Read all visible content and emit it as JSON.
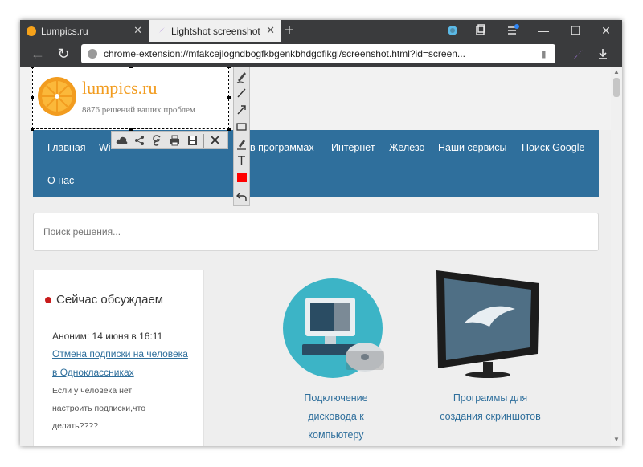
{
  "browser": {
    "tabs": [
      {
        "title": "Lumpics.ru",
        "active": false
      },
      {
        "title": "Lightshot screenshot",
        "active": true
      }
    ],
    "new_tab_icon": "plus-icon",
    "address": "chrome-extension://mfakcejlogndbogfkbgenkbhdgofikgl/screenshot.html?id=screen...",
    "colors": {
      "frame": "#3a3b3d",
      "active_tab": "#f0f0f0"
    }
  },
  "site": {
    "logo_name": "lumpics.ru",
    "logo_tagline": "8876 решений ваших проблем",
    "nav": [
      "Главная",
      "Wi",
      "в программах",
      "Интернет",
      "Железо",
      "Наши сервисы",
      "Поиск Google",
      "О нас"
    ],
    "search_placeholder": "Поиск решения...",
    "sidebar": {
      "title": "Сейчас обсуждаем",
      "comment_author": "Аноним: 14 июня в 16:11",
      "comment_link_line1": "Отмена подписки на человека",
      "comment_link_line2": "в Одноклассниках",
      "comment_text_line1": "Если у человека нет",
      "comment_text_line2": "настроить подписки,что",
      "comment_text_line3": "делать????"
    },
    "articles": [
      {
        "title_lines": [
          "Подключение",
          "дисковода к",
          "компьютеру"
        ]
      },
      {
        "title_lines": [
          "Программы для",
          "создания скриншотов"
        ]
      }
    ],
    "colors": {
      "nav_bg": "#2f6f9c",
      "link": "#2f6f9c",
      "logo_orange": "#f29c1f"
    }
  },
  "lightshot": {
    "vertical_tools": [
      "pen-icon",
      "line-icon",
      "arrow-icon",
      "rectangle-icon",
      "marker-icon",
      "text-icon",
      "color-swatch-icon",
      "undo-icon"
    ],
    "horizontal_tools": [
      "upload-cloud-icon",
      "share-icon",
      "google-search-icon",
      "print-icon",
      "save-icon",
      "close-icon"
    ],
    "current_color": "#ff0000"
  }
}
